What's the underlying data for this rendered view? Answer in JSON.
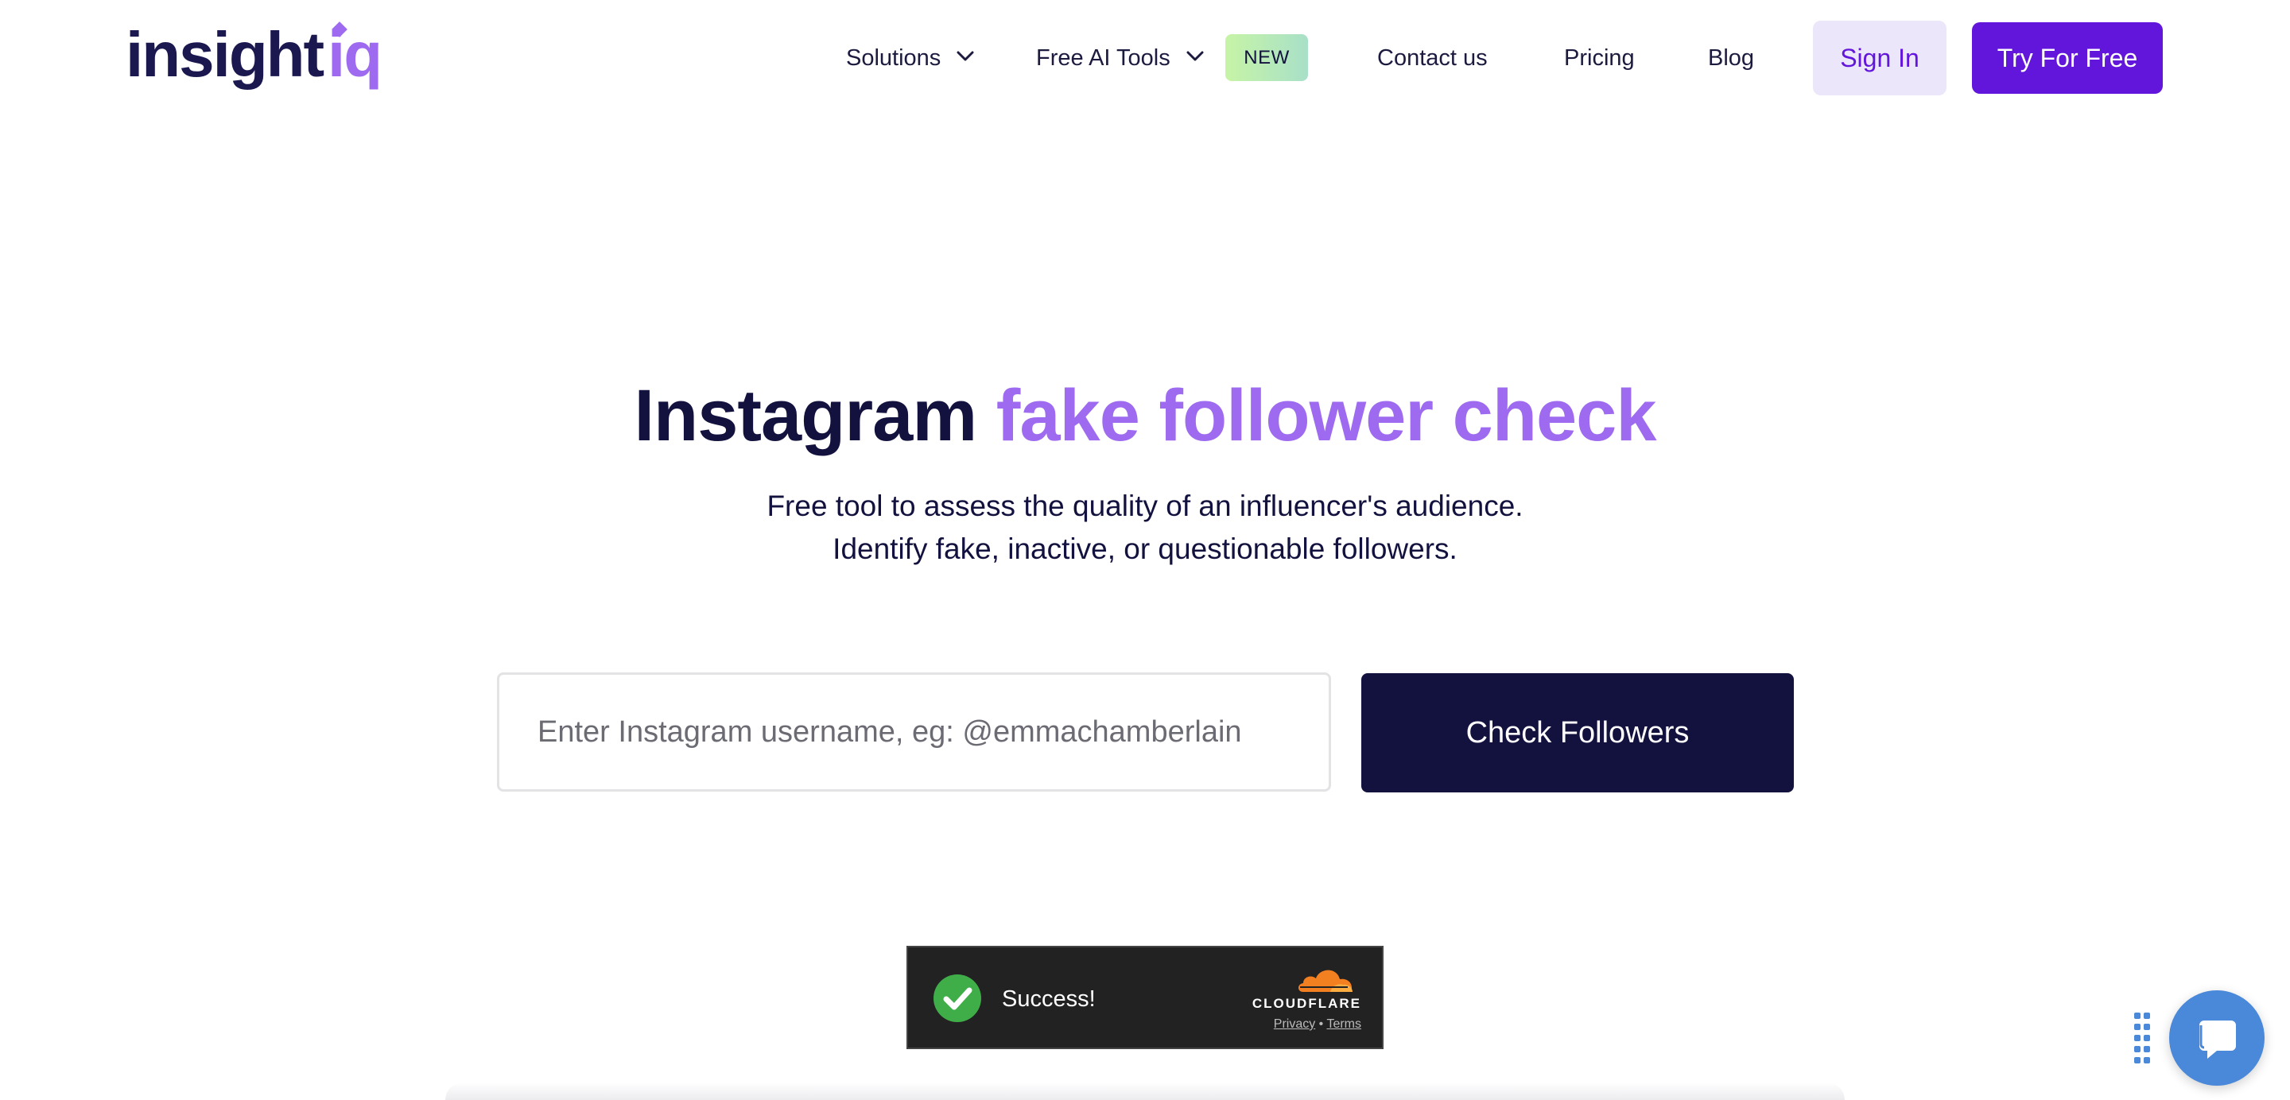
{
  "brand": {
    "logo_text_main": "insight",
    "logo_text_accent": "iq"
  },
  "nav": {
    "solutions": "Solutions",
    "free_ai_tools": "Free AI Tools",
    "new_badge": "NEW",
    "contact": "Contact us",
    "pricing": "Pricing",
    "blog": "Blog",
    "sign_in": "Sign In",
    "try_free": "Try For Free"
  },
  "hero": {
    "title_part1": "Instagram ",
    "title_part2": "fake follower check",
    "subtitle_line1": "Free tool to assess the quality of an influencer's audience.",
    "subtitle_line2": "Identify fake, inactive, or questionable followers."
  },
  "search": {
    "placeholder": "Enter Instagram username, eg: @emmachamberlain",
    "value": "",
    "button_label": "Check Followers"
  },
  "captcha": {
    "status": "Success!",
    "brand": "CLOUDFLARE",
    "privacy": "Privacy",
    "separator": "•",
    "terms": "Terms"
  },
  "colors": {
    "primary_purple": "#6316db",
    "accent_lavender": "#9e6bf0",
    "navy": "#13123f",
    "signin_bg": "#ebe6fa",
    "chat_blue": "#4a88d9",
    "success_green": "#3fae49",
    "cloudflare_orange": "#f38020"
  },
  "icons": {
    "solutions_chevron": "chevron-down-icon",
    "tools_chevron": "chevron-down-icon",
    "captcha_check": "check-circle-icon",
    "cloudflare_cloud": "cloud-icon",
    "chat": "chat-bubble-icon",
    "chat_drag": "drag-handle-icon"
  }
}
